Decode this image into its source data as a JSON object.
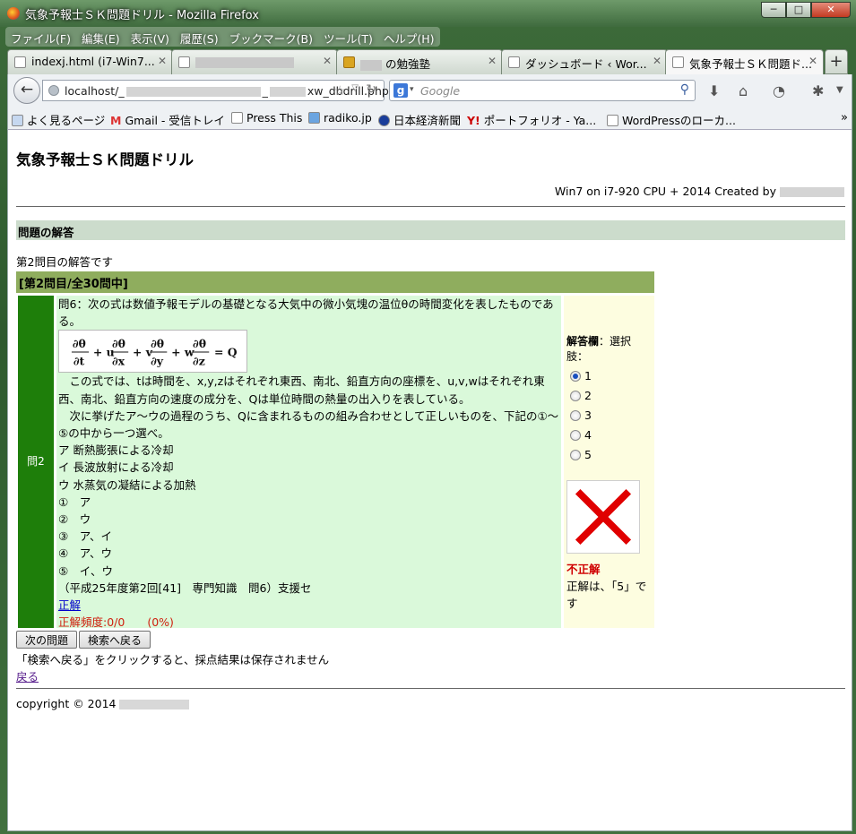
{
  "window": {
    "title": "気象予報士ＳＫ問題ドリル - Mozilla Firefox"
  },
  "menu": [
    "ファイル(F)",
    "編集(E)",
    "表示(V)",
    "履歴(S)",
    "ブックマーク(B)",
    "ツール(T)",
    "ヘルプ(H)"
  ],
  "tabs": [
    {
      "label": "indexj.html (i7-Win7..."
    },
    {
      "label": ""
    },
    {
      "label": "の勉強塾"
    },
    {
      "label": "ダッシュボード ‹ Wor..."
    },
    {
      "label": "気象予報士ＳＫ問題ド..."
    }
  ],
  "nav": {
    "url_start": "localhost/",
    "url_mid": "_",
    "url_end": "xw_dbdrill.php",
    "search_placeholder": "Google"
  },
  "bookmarks": [
    "よく見るページ",
    "Gmail - 受信トレイ",
    "Press This",
    "radiko.jp",
    "日本経済新聞",
    "ポートフォリオ - Ya...",
    "WordPressのローカ..."
  ],
  "page": {
    "title": "気象予報士ＳＫ問題ドリル",
    "created": "Win7 on i7-920 CPU + 2014 Created by",
    "section": "問題の解答",
    "answer_note": "第2問目の解答です",
    "header": "[第2問目/全30問中]",
    "qnum": "問2",
    "question_intro": "問6：次の式は数値予報モデルの基礎となる大気中の微小気塊の温位θの時間変化を表したものである。",
    "paragraph1": "　この式では、tは時間を、x,y,zはそれぞれ東西、南北、鉛直方向の座標を、u,v,wはそれぞれ東西、南北、鉛直方向の速度の成分を、Qは単位時間の熱量の出入りを表している。",
    "paragraph2": "　次に挙げたア〜ウの過程のうち、Qに含まれるものの組み合わせとして正しいものを、下記の①〜⑤の中から一つ選べ。",
    "items": [
      "ア 断熱膨張による冷却",
      "イ 長波放射による冷却",
      "ウ 水蒸気の凝結による加熱"
    ],
    "options": [
      "①　ア",
      "②　ウ",
      "③　ア、イ",
      "④　ア、ウ",
      "⑤　イ、ウ"
    ],
    "source": "（平成25年度第2回[41]　専門知識　問6）支援セ",
    "correct_link": "正解",
    "frequency": "正解頻度:0/0　　(0%)",
    "answer_label_bold": "解答欄",
    "answer_label_rest": "：選択肢：",
    "choices": [
      "1",
      "2",
      "3",
      "4",
      "5"
    ],
    "selected_choice": "1",
    "result": "不正解",
    "correct_answer": "正解は、「5」です",
    "next_button": "次の問題",
    "search_back_button": "検索へ戻る",
    "warning": "「検索へ戻る」をクリックすると、採点結果は保存されません",
    "back_link": "戻る",
    "copyright": "copyright © 2014"
  },
  "colors": {
    "header_bar": "#8fad5e",
    "qnum_cell": "#1e7e0a",
    "question_bg": "#daf9da",
    "answer_bg": "#fdfde0",
    "section_bar": "#ccdccc",
    "wrong_x": "#e00000"
  }
}
